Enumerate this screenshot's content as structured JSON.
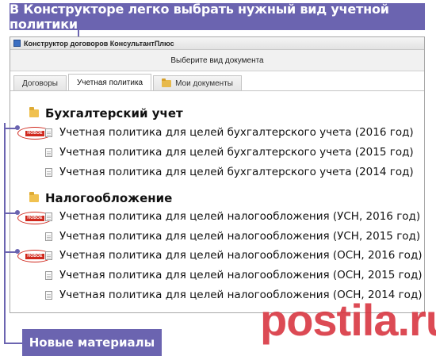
{
  "callout_top": "В Конструкторе легко выбрать нужный вид учетной политики",
  "window": {
    "title": "Конструктор договоров КонсультантПлюс",
    "subheader": "Выберите вид документа",
    "tabs": [
      {
        "label": "Договоры",
        "active": false,
        "icon": ""
      },
      {
        "label": "Учетная политика",
        "active": true,
        "icon": ""
      },
      {
        "label": "Мои документы",
        "active": false,
        "icon": "folder-icon"
      }
    ]
  },
  "sections": [
    {
      "title": "Бухгалтерский учет",
      "items": [
        {
          "label": "Учетная политика для целей бухгалтерского учета (2016 год)",
          "new": true
        },
        {
          "label": "Учетная политика для целей бухгалтерского учета (2015 год)",
          "new": false
        },
        {
          "label": "Учетная политика для целей бухгалтерского учета (2014 год)",
          "new": false
        }
      ]
    },
    {
      "title": "Налогообложение",
      "items": [
        {
          "label": "Учетная политика для целей налогообложения (УСН, 2016 год)",
          "new": true
        },
        {
          "label": "Учетная политика для целей налогообложения (УСН, 2015 год)",
          "new": false
        },
        {
          "label": "Учетная политика для целей налогообложения (ОСН, 2016 год)",
          "new": true
        },
        {
          "label": "Учетная политика для целей налогообложения (ОСН, 2015 год)",
          "new": false
        },
        {
          "label": "Учетная политика для целей налогообложения (ОСН, 2014 год)",
          "new": false
        }
      ]
    }
  ],
  "new_badge": "НОВОЕ",
  "callout_bottom": "Новые материалы",
  "watermark": "postila.ru",
  "colors": {
    "callout": "#6b64b0",
    "badge": "#d0281d",
    "watermark": "#d8323d",
    "folder": "#f0c150"
  }
}
